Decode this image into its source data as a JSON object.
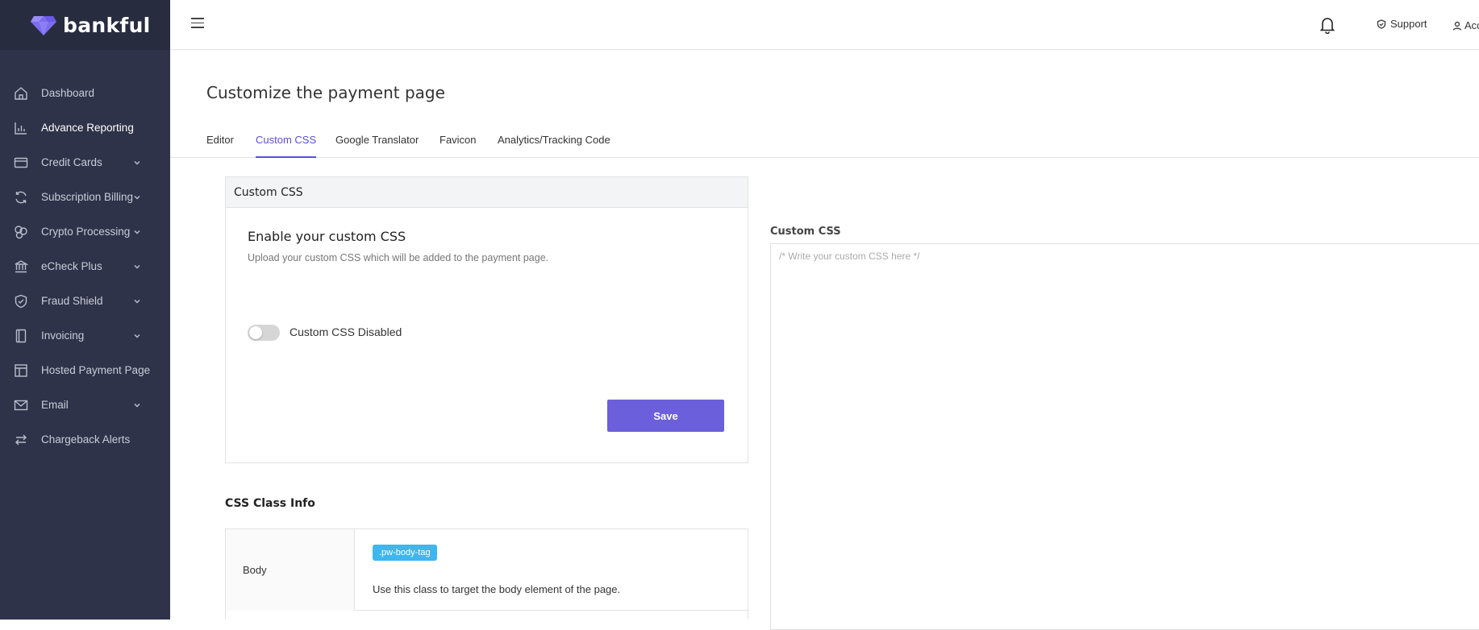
{
  "brand": {
    "name": "bankful",
    "accent": "#6c5fdb"
  },
  "sidebar": {
    "items": [
      {
        "label": "Dashboard",
        "icon": "home-icon",
        "has_submenu": false
      },
      {
        "label": "Advance Reporting",
        "icon": "bar-chart-icon",
        "has_submenu": false
      },
      {
        "label": "Credit Cards",
        "icon": "credit-card-icon",
        "has_submenu": true
      },
      {
        "label": "Subscription Billing",
        "icon": "refresh-icon",
        "has_submenu": true
      },
      {
        "label": "Crypto Processing",
        "icon": "coins-icon",
        "has_submenu": true
      },
      {
        "label": "eCheck Plus",
        "icon": "bank-icon",
        "has_submenu": true
      },
      {
        "label": "Fraud Shield",
        "icon": "shield-icon",
        "has_submenu": true
      },
      {
        "label": "Invoicing",
        "icon": "book-icon",
        "has_submenu": true
      },
      {
        "label": "Hosted Payment Page",
        "icon": "layout-icon",
        "has_submenu": false
      },
      {
        "label": "Email",
        "icon": "mail-icon",
        "has_submenu": true
      },
      {
        "label": "Chargeback Alerts",
        "icon": "arrows-icon",
        "has_submenu": false
      }
    ]
  },
  "topbar": {
    "support_label": "Support",
    "account_label": "Acc"
  },
  "page": {
    "title": "Customize the payment page",
    "tabs": [
      {
        "label": "Editor",
        "active": false
      },
      {
        "label": "Custom CSS",
        "active": true
      },
      {
        "label": "Google Translator",
        "active": false
      },
      {
        "label": "Favicon",
        "active": false
      },
      {
        "label": "Analytics/Tracking Code",
        "active": false
      }
    ]
  },
  "custom_css_card": {
    "header": "Custom CSS",
    "title": "Enable your custom CSS",
    "subtitle": "Upload your custom CSS which will be added to the payment page.",
    "toggle_on": false,
    "toggle_label": "Custom CSS Disabled",
    "save_label": "Save"
  },
  "class_info": {
    "title": "CSS Class Info",
    "rows": [
      {
        "name": "Body",
        "class": ".pw-body-tag",
        "description": "Use this class to target the body element of the page."
      }
    ]
  },
  "editor": {
    "label": "Custom CSS",
    "placeholder": "/* Write your custom CSS here */",
    "value": ""
  }
}
